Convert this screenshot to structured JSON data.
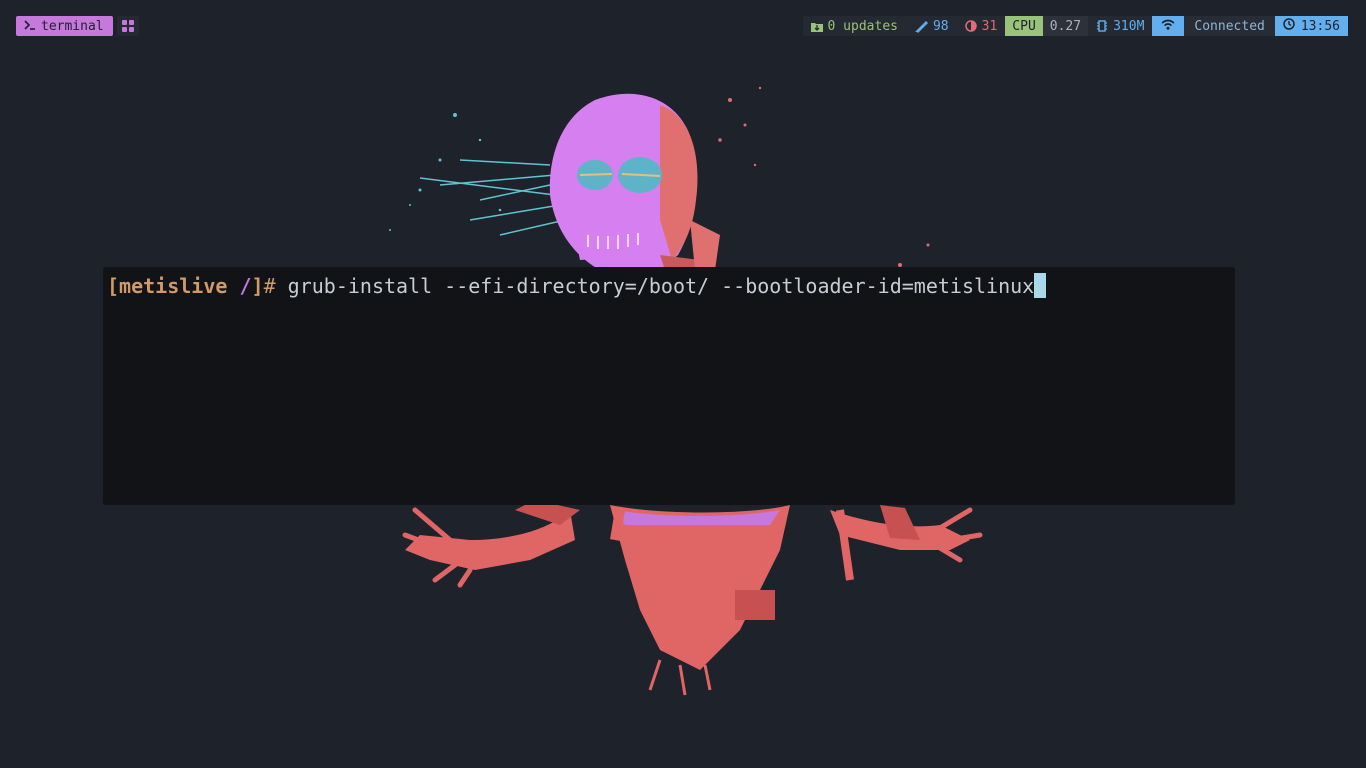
{
  "workspaces": {
    "active_label": "terminal",
    "active_icon": "terminal-prompt-icon",
    "grid_icon": "grid-icon"
  },
  "status": {
    "updates": {
      "icon": "package-update-icon",
      "text": "0 updates",
      "color": "#98c379"
    },
    "brightness": {
      "icon": "pen-brightness-icon",
      "value": "98",
      "color": "#61afef"
    },
    "volume": {
      "icon": "half-circle-icon",
      "value": "31",
      "color": "#e06c75"
    },
    "cpu": {
      "label": "CPU",
      "value": "0.27",
      "accent": "#98c379"
    },
    "memory": {
      "icon": "chip-icon",
      "value": "310M",
      "color": "#61afef"
    },
    "network": {
      "icon": "wifi-icon",
      "text": "Connected",
      "accent": "#61afef"
    },
    "clock": {
      "icon": "clock-icon",
      "time": "13:56"
    }
  },
  "terminal": {
    "prompt_open": "[",
    "prompt_user": "metislive",
    "prompt_path": " /",
    "prompt_close": "]",
    "prompt_symbol": "#",
    "command": " grub-install --efi-directory=/boot/ --bootloader-id=metislinux"
  },
  "colors": {
    "background": "#1e222a",
    "terminal_bg": "#111317",
    "accent_purple": "#c678dd",
    "accent_orange": "#d19a66"
  }
}
